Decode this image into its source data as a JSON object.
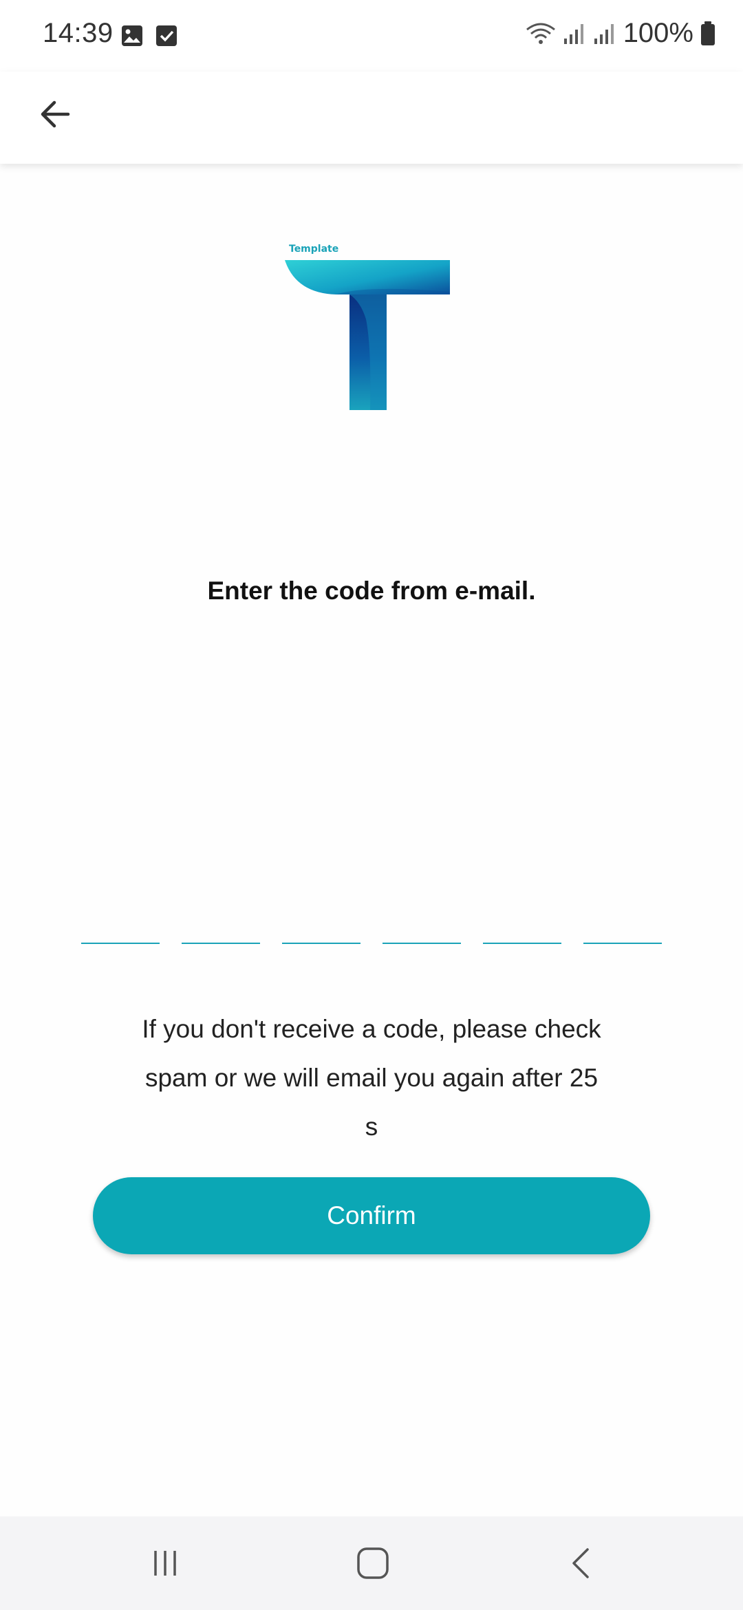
{
  "status_bar": {
    "time": "14:39",
    "left_icons": [
      "image-icon",
      "checkbox-icon"
    ],
    "right_icons": [
      "wifi-icon",
      "signal-icon",
      "signal-icon"
    ],
    "battery_text": "100%",
    "battery_icon": "battery-icon"
  },
  "app_bar": {
    "back_icon": "arrow-left-icon"
  },
  "logo": {
    "label": "Template",
    "colors": [
      "#2bc4cf",
      "#0a3f8c",
      "#17a6bf"
    ]
  },
  "main": {
    "heading": "Enter the code from e-mail.",
    "code_cells": [
      "",
      "",
      "",
      "",
      "",
      ""
    ],
    "hint_line1": "If you don't receive a code, please check",
    "hint_line2": "spam or we will email you again after 25",
    "hint_line3": "s",
    "confirm_label": "Confirm"
  },
  "colors": {
    "accent": "#0ba7b5",
    "underline": "#1aa3b8"
  },
  "nav_bar": {
    "icons": [
      "recent-apps-icon",
      "home-icon",
      "back-icon"
    ]
  }
}
